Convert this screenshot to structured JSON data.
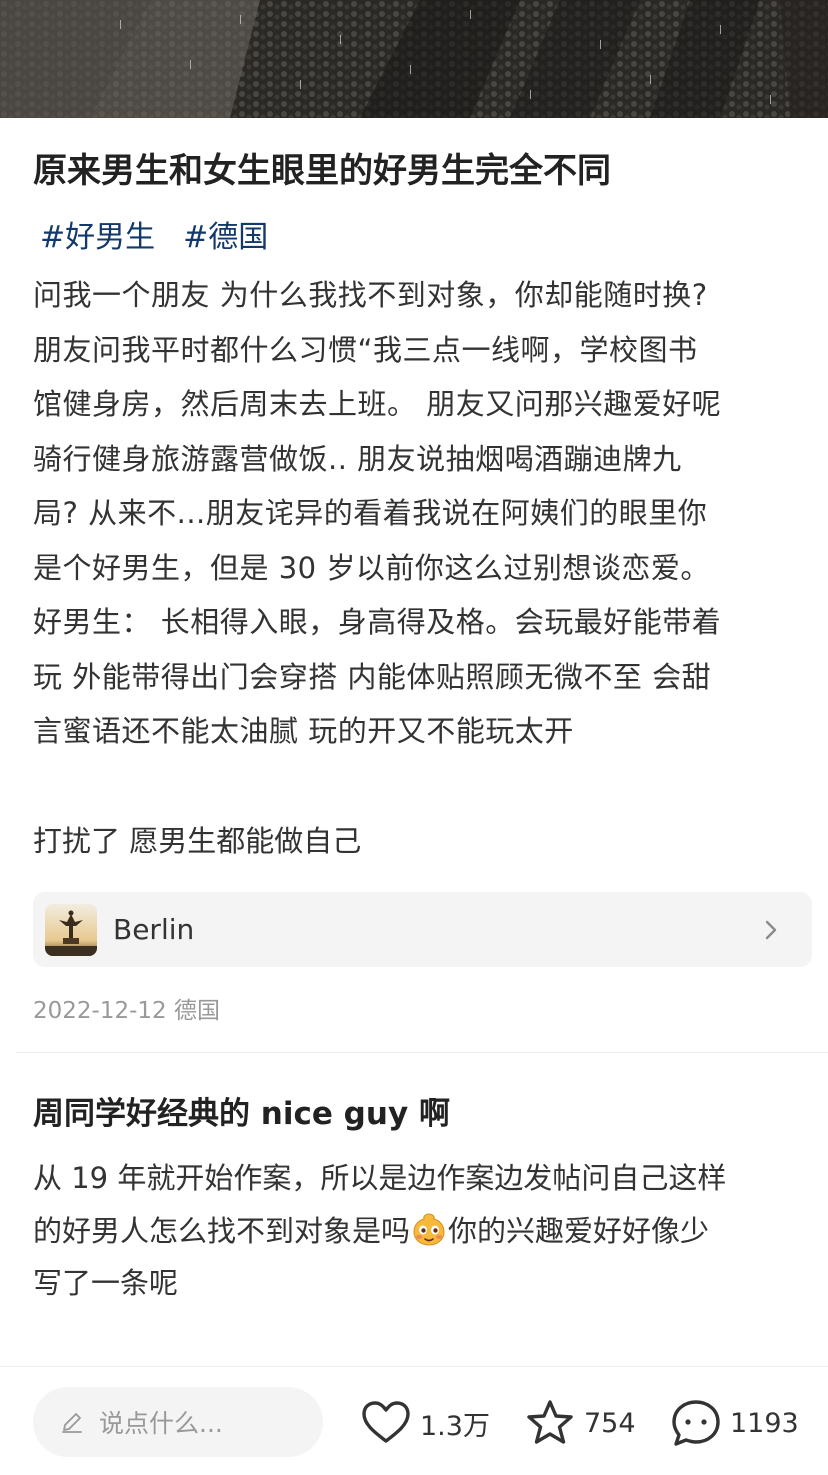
{
  "post": {
    "title": "原来男生和女生眼里的好男生完全不同",
    "tags": [
      "#好男生",
      "#德国"
    ],
    "body": "问我一个朋友 为什么我找不到对象，你却能随时换?\n朋友问我平时都什么习惯“我三点一线啊，学校图书\n馆健身房，然后周末去上班。 朋友又问那兴趣爱好呢\n骑行健身旅游露营做饭.. 朋友说抽烟喝酒蹦迪牌九\n局? 从来不...朋友诧异的看着我说在阿姨们的眼里你\n是个好男生，但是 30 岁以前你这么过别想谈恋爱。\n好男生： 长相得入眼，身高得及格。会玩最好能带着\n玩 外能带得出门会穿搭 内能体贴照顾无微不至 会甜\n言蜜语还不能太油腻 玩的开又不能玩太开",
    "sign_off": "打扰了 愿男生都能做自己",
    "location": {
      "name": "Berlin",
      "thumb_icon": "victory-column-photo",
      "chevron_icon": "chevron-right-icon"
    },
    "meta": "2022-12-12 德国"
  },
  "top_comment": {
    "title": "周同学好经典的 nice guy 啊",
    "text_before_emoji": "从 19 年就开始作案，所以是边作案边发帖问自己这样\n的好男人怎么找不到对象是吗",
    "emoji_icon": "sly-face-emoji",
    "text_after_emoji": "你的兴趣爱好好像少\n写了一条呢"
  },
  "bottom_bar": {
    "input_placeholder": "说点什么...",
    "likes": "1.3万",
    "collects": "754",
    "comments": "1193"
  },
  "colors": {
    "tag": "#13386c",
    "text": "#333333",
    "muted": "#999999",
    "card_bg": "#f4f4f4"
  }
}
